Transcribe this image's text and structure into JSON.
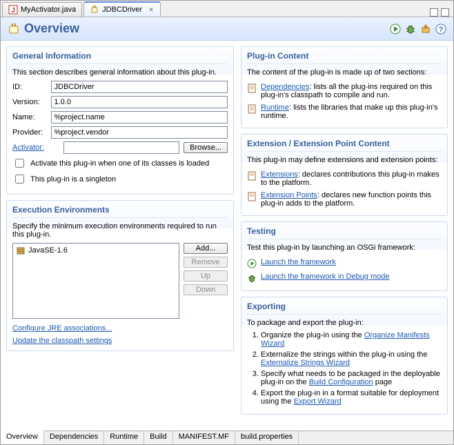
{
  "tabs": [
    {
      "label": "MyActivator.java",
      "active": false
    },
    {
      "label": "JDBCDriver",
      "active": true
    }
  ],
  "header": {
    "title": "Overview"
  },
  "general": {
    "title": "General Information",
    "desc": "This section describes general information about this plug-in.",
    "id_label": "ID:",
    "id_value": "JDBCDriver",
    "version_label": "Version:",
    "version_value": "1.0.0",
    "name_label": "Name:",
    "name_value": "%project.name",
    "provider_label": "Provider:",
    "provider_value": "%project.vendor",
    "activator_label": "Activator:",
    "activator_value": "",
    "browse_label": "Browse...",
    "chk_activate": "Activate this plug-in when one of its classes is loaded",
    "chk_singleton": "This plug-in is a singleton"
  },
  "exec": {
    "title": "Execution Environments",
    "desc": "Specify the minimum execution environments required to run this plug-in.",
    "items": [
      {
        "label": "JavaSE-1.6"
      }
    ],
    "add_label": "Add...",
    "remove_label": "Remove",
    "up_label": "Up",
    "down_label": "Down",
    "link1": "Configure JRE associations...",
    "link2": "Update the classpath settings"
  },
  "plugin_content": {
    "title": "Plug-in Content",
    "desc": "The content of the plug-in is made up of two sections:",
    "dep_link": "Dependencies",
    "dep_text": ": lists all the plug-ins required on this plug-in's classpath to compile and run.",
    "run_link": "Runtime",
    "run_text": ": lists the libraries that make up this plug-in's runtime."
  },
  "ext_content": {
    "title": "Extension / Extension Point Content",
    "desc": "This plug-in may define extensions and extension points:",
    "ext_link": "Extensions",
    "ext_text": ": declares contributions this plug-in makes to the platform.",
    "extp_link": "Extension Points",
    "extp_text": ": declares new function points this plug-in adds to the platform."
  },
  "testing": {
    "title": "Testing",
    "desc": "Test this plug-in by launching an OSGi framework:",
    "launch_link": "Launch the framework",
    "debug_link": "Launch the framework in Debug mode"
  },
  "exporting": {
    "title": "Exporting",
    "desc": "To package and export the plug-in:",
    "s1a": "Organize the plug-in using the ",
    "s1l": "Organize Manifests Wizard",
    "s2a": "Externalize the strings within the plug-in using the ",
    "s2l": "Externalize Strings Wizard",
    "s3a": "Specify what needs to be packaged in the deployable plug-in on the ",
    "s3l": "Build Configuration",
    "s3b": " page",
    "s4a": "Export the plug-in in a format suitable for deployment using the ",
    "s4l": "Export Wizard"
  },
  "bottom_tabs": [
    {
      "label": "Overview",
      "active": true
    },
    {
      "label": "Dependencies",
      "active": false
    },
    {
      "label": "Runtime",
      "active": false
    },
    {
      "label": "Build",
      "active": false
    },
    {
      "label": "MANIFEST.MF",
      "active": false
    },
    {
      "label": "build.properties",
      "active": false
    }
  ]
}
